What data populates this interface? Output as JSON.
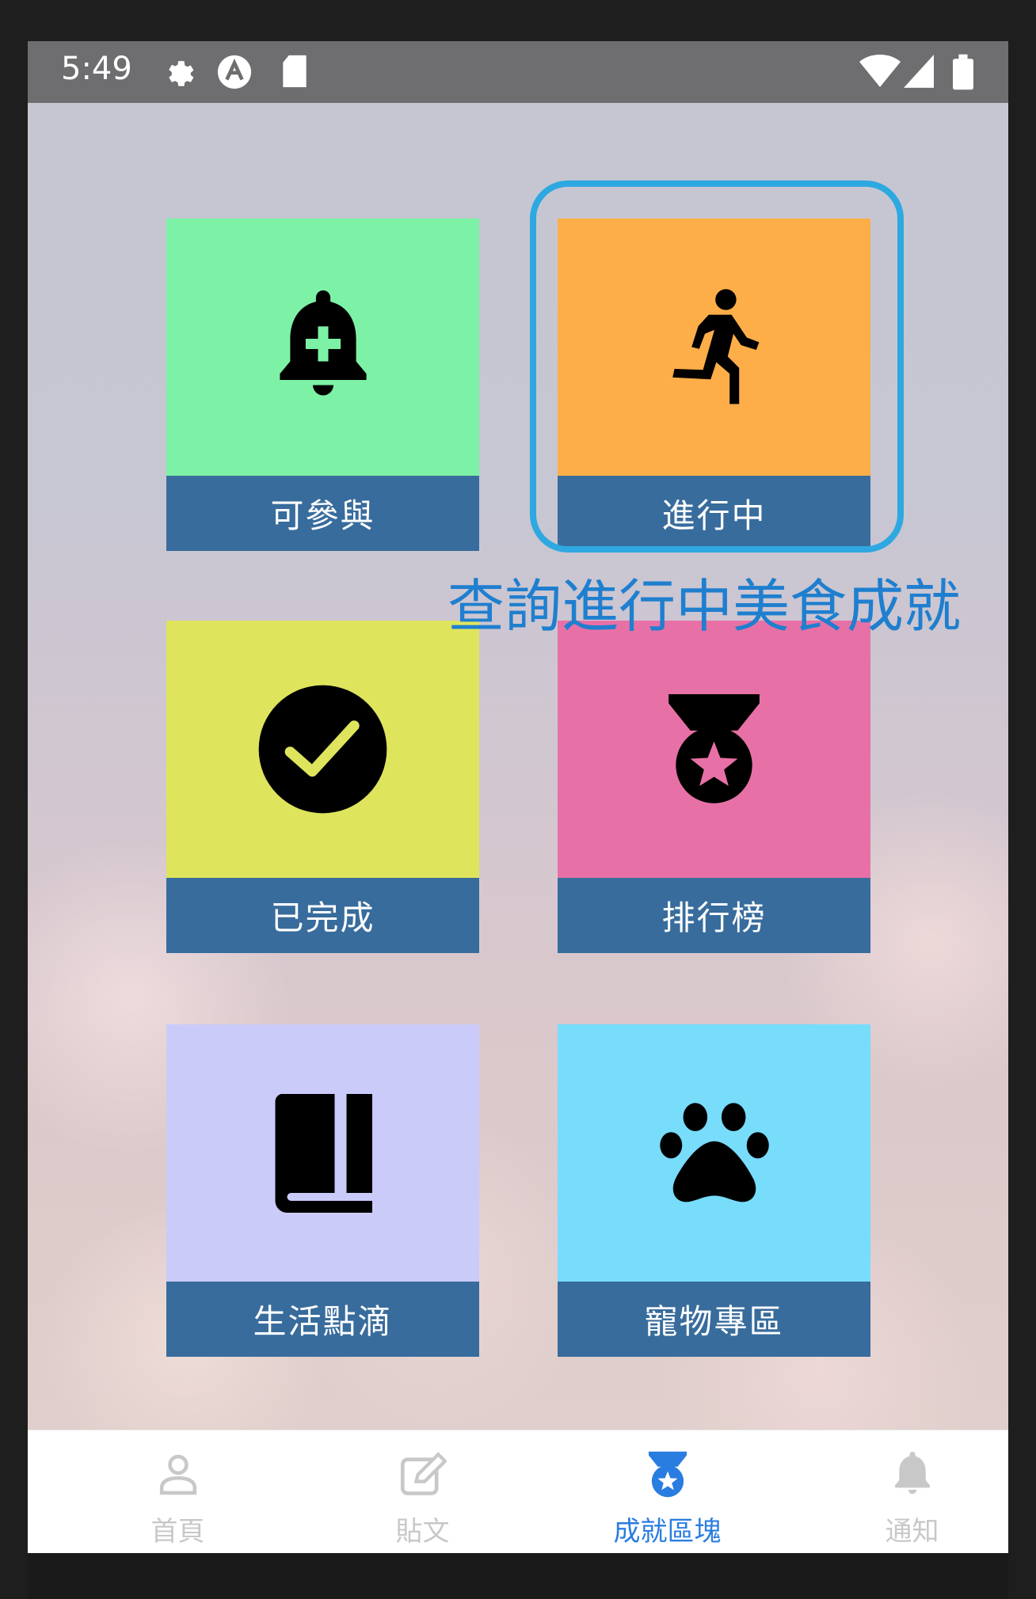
{
  "status_bar": {
    "time": "5:49",
    "icons": [
      "gear-icon",
      "a-circle-icon",
      "sd-card-icon",
      "wifi-icon",
      "signal-icon",
      "battery-icon"
    ]
  },
  "tiles": [
    {
      "label": "可參與",
      "icon": "bell-plus-icon",
      "color": "#7df2a6"
    },
    {
      "label": "進行中",
      "icon": "running-icon",
      "color": "#fdae48"
    },
    {
      "label": "已完成",
      "icon": "check-circle-icon",
      "color": "#dee55d"
    },
    {
      "label": "排行榜",
      "icon": "medal-icon",
      "color": "#e771a6"
    },
    {
      "label": "生活點滴",
      "icon": "book-icon",
      "color": "#cbcbfa"
    },
    {
      "label": "寵物專區",
      "icon": "paw-icon",
      "color": "#78dcfb"
    }
  ],
  "annotation": {
    "text": "查詢進行中美食成就",
    "color": "#1f7fcf"
  },
  "tab_bar": {
    "tabs": [
      {
        "label": "首頁",
        "icon": "person-icon",
        "active": false
      },
      {
        "label": "貼文",
        "icon": "edit-icon",
        "active": false
      },
      {
        "label": "成就區塊",
        "icon": "medal-icon",
        "active": true
      },
      {
        "label": "通知",
        "icon": "bell-icon",
        "active": false
      }
    ],
    "active_color": "#2a7de0",
    "inactive_color": "#c8c8c8"
  }
}
